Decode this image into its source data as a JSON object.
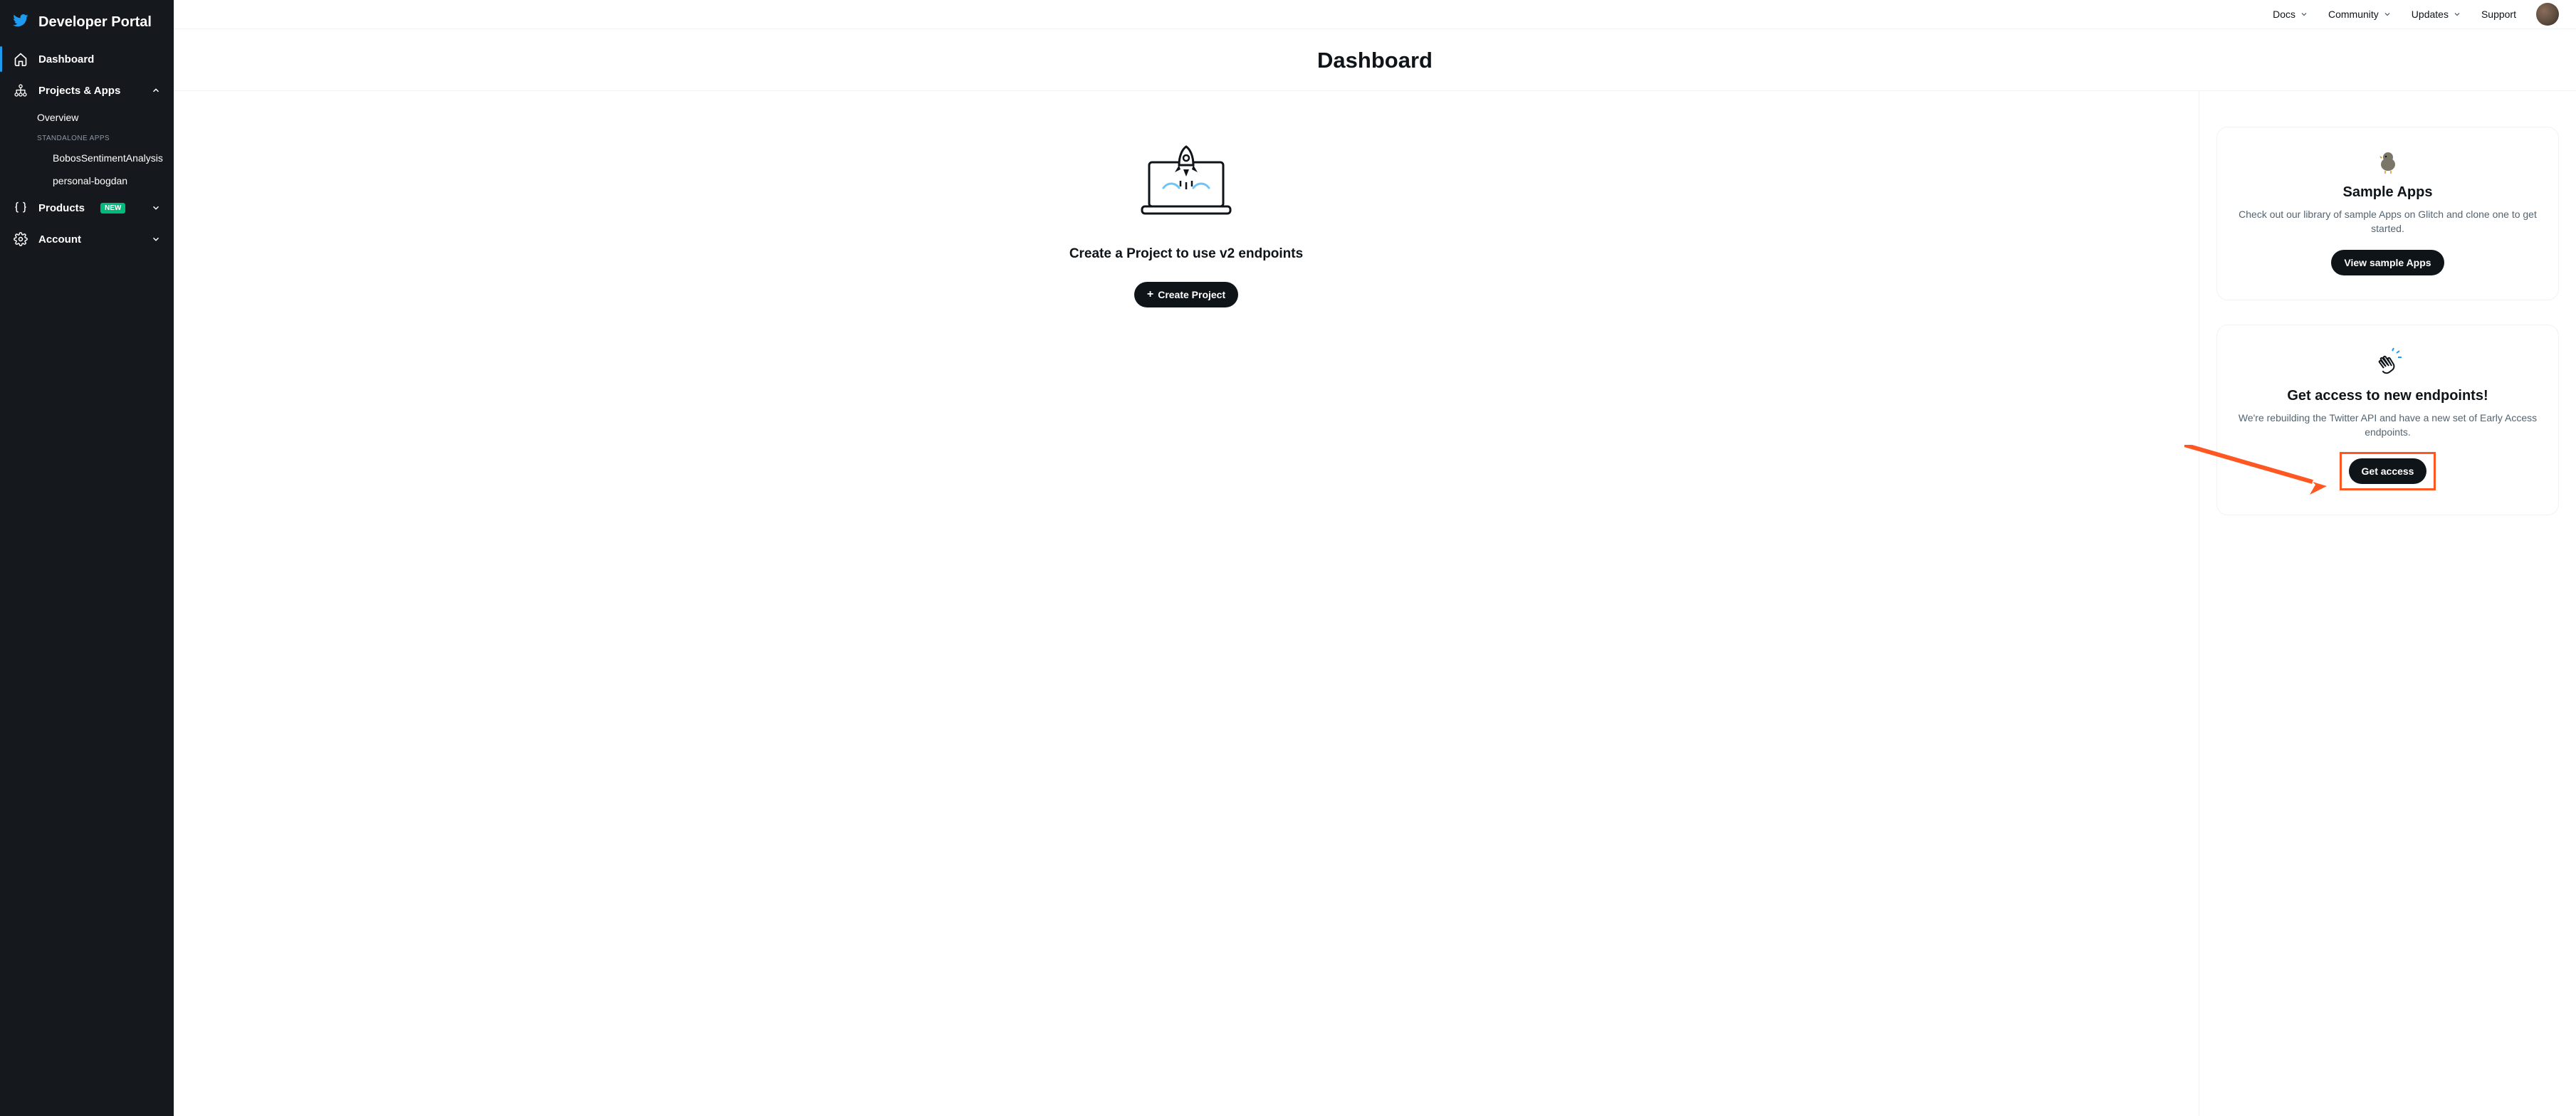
{
  "brand": {
    "title": "Developer Portal"
  },
  "sidebar": {
    "dashboard": "Dashboard",
    "projects_apps": "Projects & Apps",
    "overview": "Overview",
    "standalone_label": "STANDALONE APPS",
    "apps": [
      "BobosSentimentAnalysis",
      "personal-bogdan"
    ],
    "products": "Products",
    "products_badge": "NEW",
    "account": "Account"
  },
  "topbar": {
    "docs": "Docs",
    "community": "Community",
    "updates": "Updates",
    "support": "Support"
  },
  "page": {
    "title": "Dashboard"
  },
  "hero": {
    "heading": "Create a Project to use v2 endpoints",
    "cta": "Create Project"
  },
  "cards": {
    "sample": {
      "title": "Sample Apps",
      "desc": "Check out our library of sample Apps on Glitch and clone one to get started.",
      "cta": "View sample Apps"
    },
    "access": {
      "title": "Get access to new endpoints!",
      "desc": "We're rebuilding the Twitter API and have a new set of Early Access endpoints.",
      "cta": "Get access"
    }
  },
  "colors": {
    "annotation": "#ff5722",
    "accent": "#1d9bf0"
  }
}
